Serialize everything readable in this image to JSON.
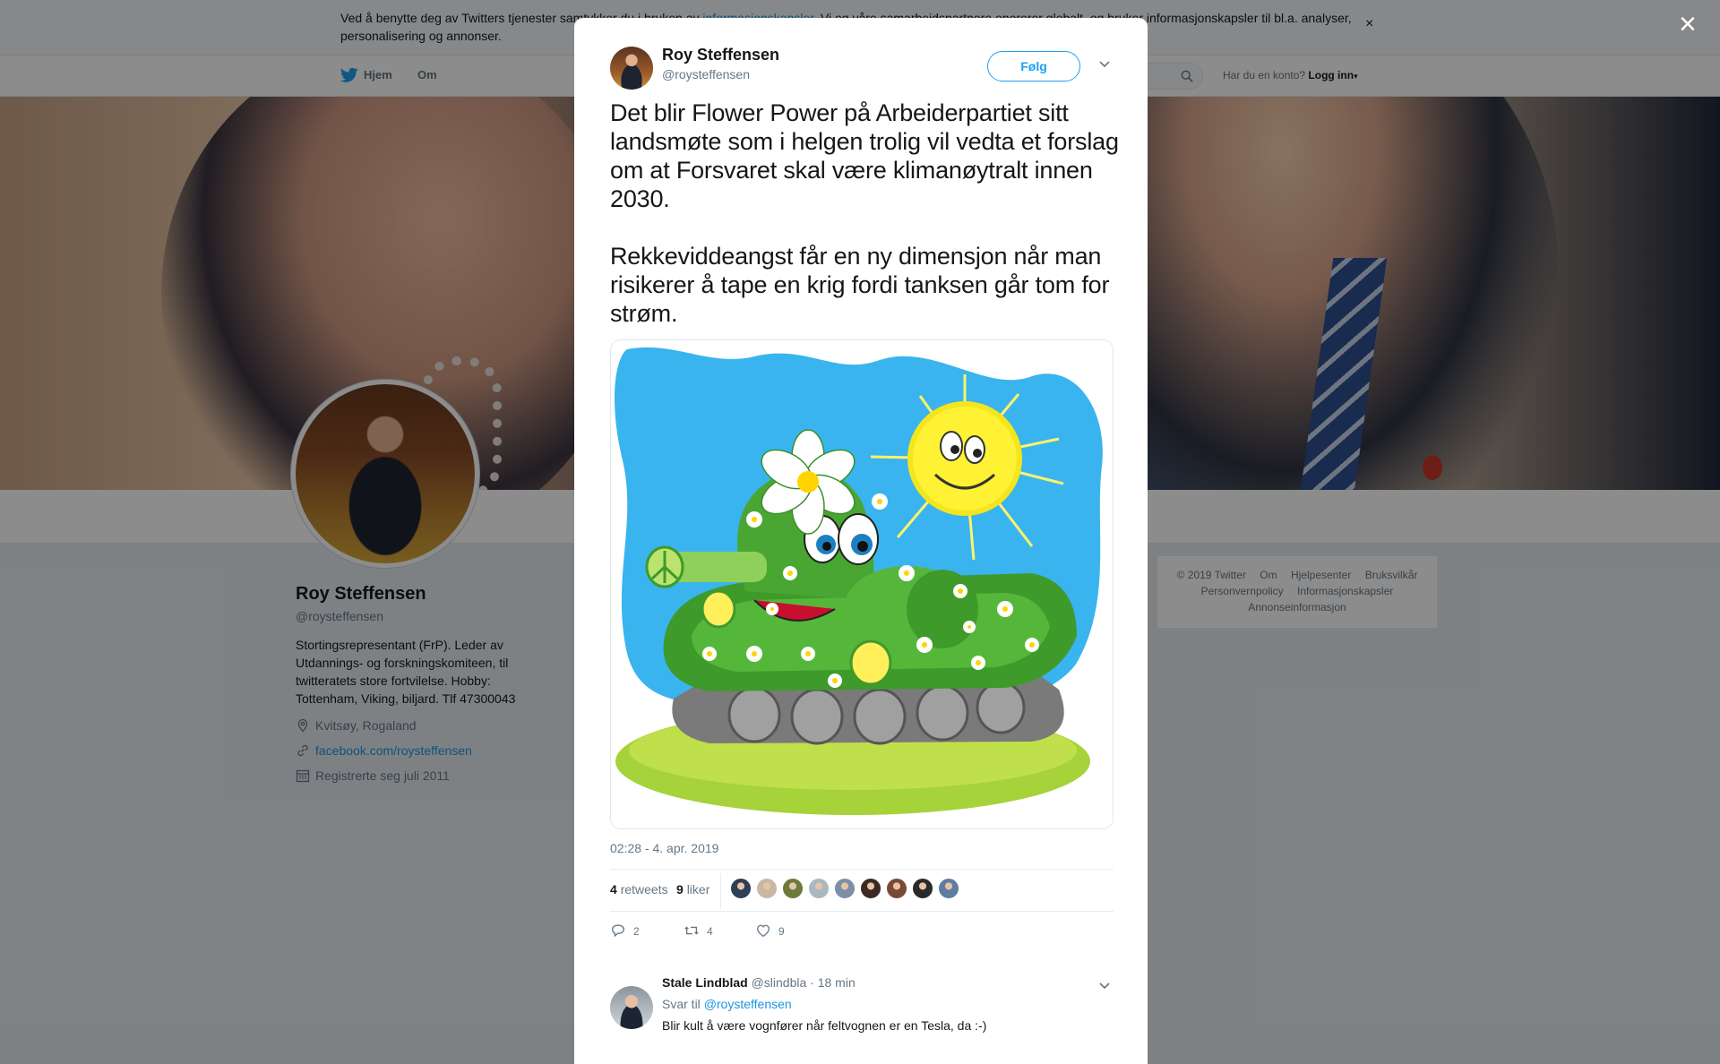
{
  "cookie_bar": {
    "text_before": "Ved å benytte deg av Twitters tjenester samtykker du i bruken av ",
    "link": "informasjonskapsler",
    "text_after": ". Vi og våre samarbeidspartnere opererer globalt, og bruker informasjonskapsler til bl.a. analyser, personalisering og annonser.",
    "close": "×"
  },
  "nav": {
    "home": "Hjem",
    "about": "Om",
    "account_question": "Har du en konto?",
    "login": "Logg inn"
  },
  "profile": {
    "name": "Roy Steffensen",
    "handle": "@roysteffensen",
    "bio": "Stortingsrepresentant (FrP). Leder av Utdannings- og forskningskomiteen, til twitteratets store fortvilelse. Hobby: Tottenham, Viking, biljard. Tlf 47300043",
    "location": "Kvitsøy, Rogaland",
    "website": "facebook.com/roysteffensen",
    "joined": "Registrerte seg juli 2011"
  },
  "footer": {
    "items": [
      "© 2019 Twitter",
      "Om",
      "Hjelpesenter",
      "Bruksvilkår",
      "Personvernpolicy",
      "Informasjonskapsler",
      "Annonseinformasjon"
    ]
  },
  "overlay": {
    "close": "×"
  },
  "tweet": {
    "author_name": "Roy Steffensen",
    "author_handle": "@roysteffensen",
    "follow_label": "Følg",
    "paragraph1": "Det blir Flower Power på Arbeiderpartiet sitt landsmøte som i helgen trolig vil vedta et forslag om at Forsvaret skal være klimanøytralt innen 2030.",
    "paragraph2": "Rekkeviddeangst får en ny dimensjon når man risikerer å tape en krig fordi tanksen går tom for strøm.",
    "timestamp": "02:28 - 4. apr. 2019",
    "retweets_count": "4",
    "retweets_label": "retweets",
    "likes_count": "9",
    "likes_label": "liker",
    "reply_count": "2",
    "retweet_action_count": "4",
    "like_action_count": "9"
  },
  "likers": [
    {
      "icon": "liker-avatar",
      "color": "#2e3f58"
    },
    {
      "icon": "liker-avatar",
      "color": "#c9b7a5"
    },
    {
      "icon": "liker-avatar",
      "color": "#6e7a3c"
    },
    {
      "icon": "liker-avatar",
      "color": "#aab8c2"
    },
    {
      "icon": "liker-avatar",
      "color": "#7d8fa6"
    },
    {
      "icon": "liker-avatar",
      "color": "#3b2a22"
    },
    {
      "icon": "liker-avatar",
      "color": "#7a4a36"
    },
    {
      "icon": "liker-avatar",
      "color": "#2a2a2a"
    },
    {
      "icon": "liker-avatar",
      "color": "#5f7da2"
    }
  ],
  "reply": {
    "name": "Stale Lindblad",
    "handle": "@slindbla",
    "time": "· 18 min",
    "reply_to_label": "Svar til",
    "reply_to_handle": "@roysteffensen",
    "text": "Blir kult å være vognfører når feltvognen er en Tesla, da :-)"
  },
  "colors": {
    "accent": "#1da1f2",
    "link": "#1b95e0",
    "text": "#14171a",
    "secondary": "#657786"
  }
}
